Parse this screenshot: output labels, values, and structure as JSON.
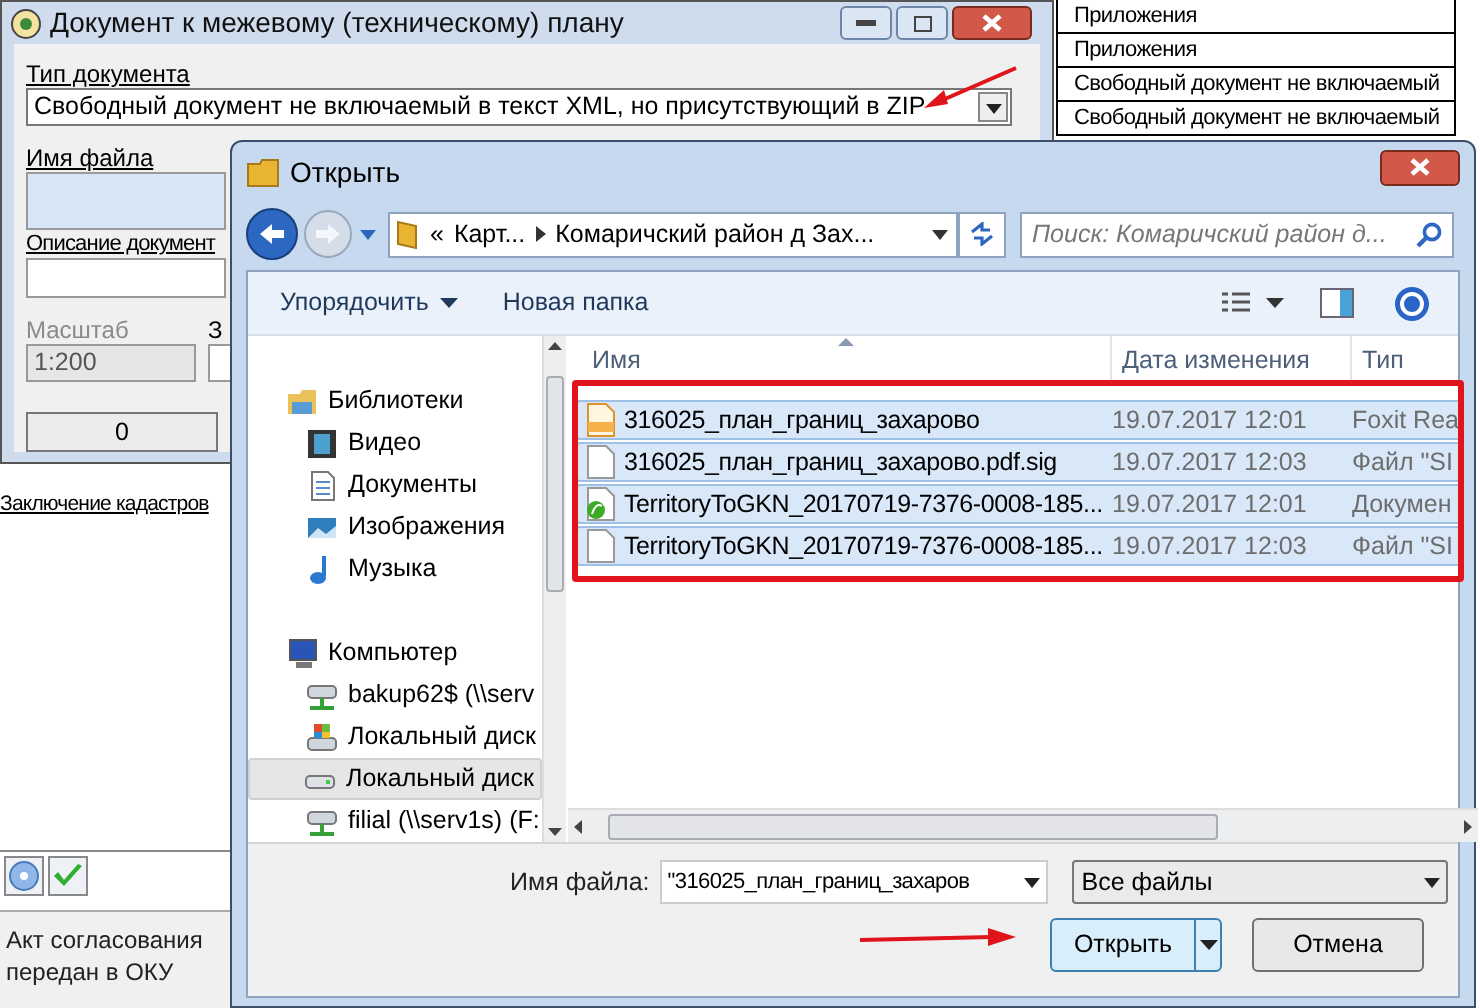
{
  "background_table": {
    "rows": [
      {
        "cell": "Приложения"
      },
      {
        "cell": "Приложения"
      },
      {
        "cell": "Свободный документ не включаемый"
      },
      {
        "cell": "Свободный документ не включаемый"
      }
    ]
  },
  "left_panel": {
    "section_label": "Заключение кадастров",
    "tool_buttons": [
      {
        "kind": "disc"
      },
      {
        "kind": "check"
      }
    ],
    "status_text": "Акт согласования передан в ОКУ"
  },
  "document_dialog": {
    "title": "Документ к межевому (техническому) плану",
    "document_type": {
      "label": "Тип документа",
      "value": "Свободный документ не включаемый в текст XML, но присутствующий в ZIP"
    },
    "file_name": {
      "label": "Имя файла"
    },
    "description": {
      "label": "Описание документ"
    },
    "scale": {
      "label": "Масштаб",
      "value": "1:200",
      "disabled": true
    },
    "field_4": {
      "label": "З"
    },
    "count_button": "0"
  },
  "open_dialog": {
    "title": "Открыть",
    "breadcrumb_prefix": "«",
    "breadcrumb": [
      "Карт...",
      "Комаричский район д Зах..."
    ],
    "search": {
      "placeholder": "Поиск: Комаричский район д..."
    },
    "toolbar": {
      "organize": "Упорядочить",
      "new_folder": "Новая папка"
    },
    "nav": [
      {
        "label": "Библиотеки",
        "kind": "library",
        "selected": false,
        "children": [
          {
            "label": "Видео",
            "kind": "video",
            "selected": false
          },
          {
            "label": "Документы",
            "kind": "documents",
            "selected": false
          },
          {
            "label": "Изображения",
            "kind": "pictures",
            "selected": false
          },
          {
            "label": "Музыка",
            "kind": "music",
            "selected": false
          }
        ]
      },
      {
        "label": "Компьютер",
        "kind": "computer",
        "selected": false,
        "children": [
          {
            "label": "bakup62$ (\\\\serv",
            "kind": "network",
            "selected": false
          },
          {
            "label": "Локальный диск",
            "kind": "system-drive",
            "selected": false
          },
          {
            "label": "Локальный диск",
            "kind": "drive",
            "selected": true
          },
          {
            "label": "filial (\\\\serv1s) (F:",
            "kind": "network",
            "selected": false
          }
        ]
      }
    ],
    "columns": [
      "Имя",
      "Дата изменения",
      "Тип"
    ],
    "files": [
      {
        "name": "316025_план_границ_захарово",
        "date": "19.07.2017 12:01",
        "type": "Foxit Rea",
        "kind": "pdf",
        "selected": true
      },
      {
        "name": "316025_план_границ_захарово.pdf.sig",
        "date": "19.07.2017 12:03",
        "type": "Файл \"SI",
        "kind": "blank",
        "selected": true
      },
      {
        "name": "TerritoryToGKN_20170719-7376-0008-185...",
        "date": "19.07.2017 12:01",
        "type": "Докумен",
        "kind": "xml",
        "selected": true
      },
      {
        "name": "TerritoryToGKN_20170719-7376-0008-185...",
        "date": "19.07.2017 12:03",
        "type": "Файл \"SI",
        "kind": "blank",
        "selected": true
      }
    ],
    "file_name": {
      "label": "Имя файла:",
      "value": "\"316025_план_границ_захаров"
    },
    "file_type": "Все файлы",
    "open_button": "Открыть",
    "cancel_button": "Отмена"
  }
}
